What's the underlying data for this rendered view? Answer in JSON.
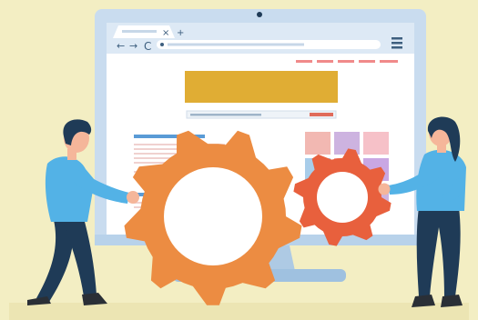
{
  "scene": {
    "subject": "website-maintenance-illustration",
    "colors": {
      "background": "#f3eec3",
      "monitor_frame": "#c9dcef",
      "monitor_stand": "#aecae4",
      "screen": "#ffffff",
      "browser_bar": "#dde9f5",
      "banner": "#e0ad34",
      "accent_blue": "#5a9bd6",
      "accent_red": "#e06b5b",
      "gear_large": "#ec8c42",
      "gear_small": "#e8603d",
      "person_shirt": "#53b2e6",
      "person_pants": "#1f3b57",
      "person_hair": "#1f3b57",
      "skin": "#f5b69a",
      "tiles": [
        "#f2b8b2",
        "#cdb3e0",
        "#f6c1c8",
        "#a8cdea",
        "#f5a3a3",
        "#c9a7e3"
      ]
    },
    "browser": {
      "tab_close_glyph": "×",
      "tab_add_glyph": "+",
      "back_glyph": "←",
      "forward_glyph": "→",
      "reload_glyph": "C",
      "menu_icon": "hamburger-icon"
    },
    "icons": [
      "cog-icon",
      "cog-icon",
      "back-arrow-icon",
      "forward-arrow-icon",
      "reload-icon",
      "hamburger-icon"
    ]
  }
}
